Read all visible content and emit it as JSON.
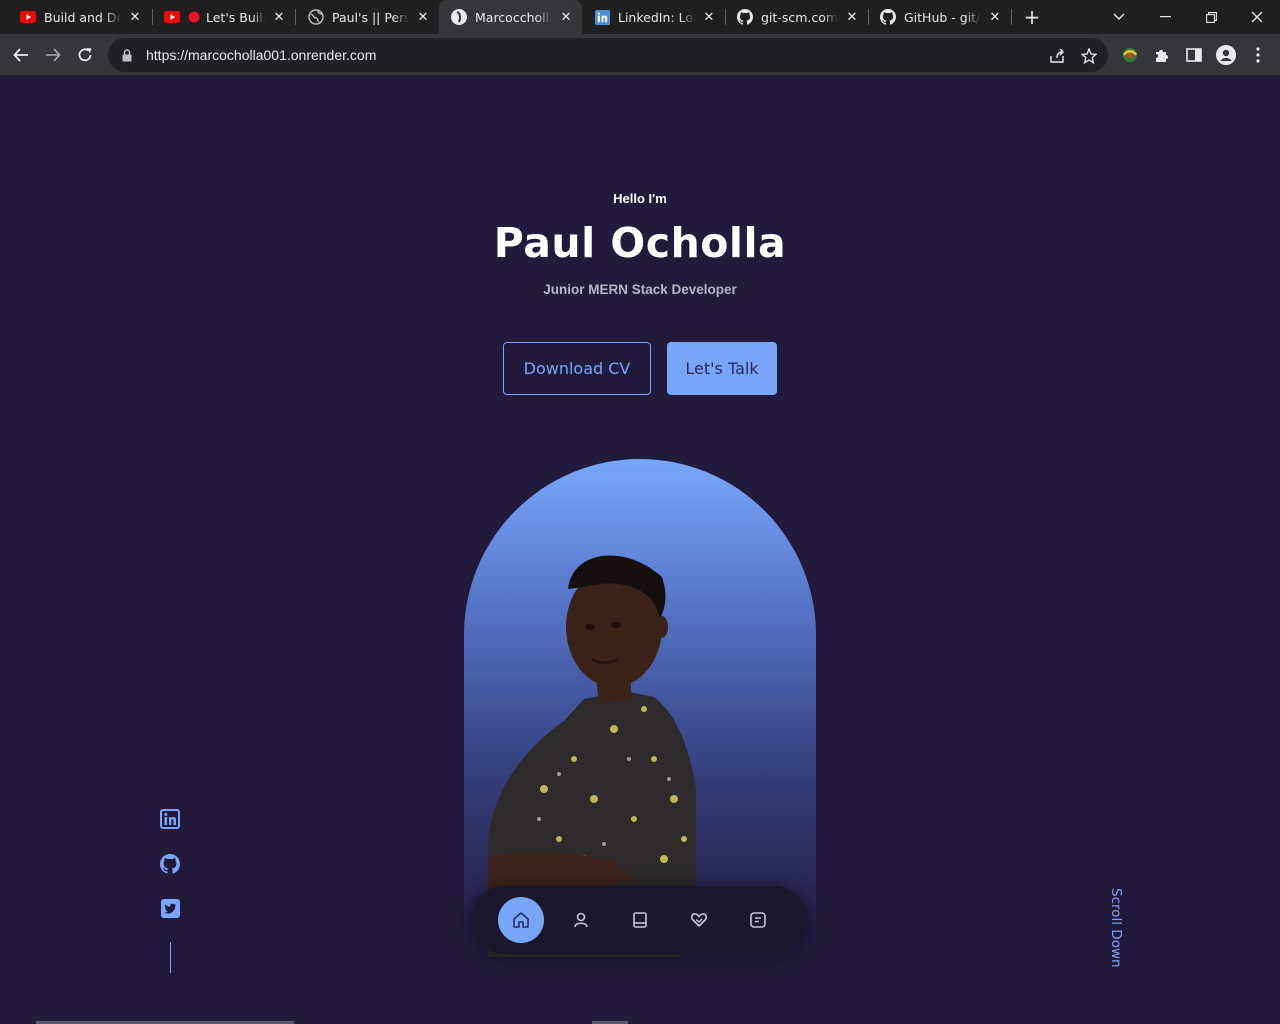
{
  "browser": {
    "tabs": [
      {
        "title": "Build and Deploy a",
        "icon": "youtube-icon"
      },
      {
        "title": "Let's Build a",
        "icon": "youtube-live-icon"
      },
      {
        "title": "Paul's || Personal",
        "icon": "globe-icon"
      },
      {
        "title": "Marcoccholla",
        "icon": "site-avatar-icon"
      },
      {
        "title": "LinkedIn: Log In",
        "icon": "linkedin-icon"
      },
      {
        "title": "git-scm.com/book",
        "icon": "github-icon"
      },
      {
        "title": "GitHub - git/git",
        "icon": "github-icon"
      }
    ],
    "active_tab": 3,
    "new_tab_label": "+",
    "url": "https://marcocholla001.onrender.com",
    "colors": {
      "tabbar": "#1f1f1f",
      "toolbar": "#35363a",
      "omnibox": "#202124"
    }
  },
  "hero": {
    "greeting": "Hello I'm",
    "name": "Paul Ocholla",
    "role": "Junior MERN Stack Developer",
    "download_cv_label": "Download CV",
    "lets_talk_label": "Let's Talk",
    "scroll_label": "Scroll Down"
  },
  "bottom_nav": {
    "items": [
      {
        "icon": "home-icon",
        "active": true
      },
      {
        "icon": "user-icon",
        "active": false
      },
      {
        "icon": "book-icon",
        "active": false
      },
      {
        "icon": "services-icon",
        "active": false
      },
      {
        "icon": "message-icon",
        "active": false
      }
    ]
  },
  "socials": [
    {
      "icon": "linkedin-icon"
    },
    {
      "icon": "github-icon"
    },
    {
      "icon": "twitter-icon"
    }
  ],
  "colors": {
    "background": "#211a3a",
    "accent": "#78a6fb",
    "text": "#ffffff",
    "muted_text": "#b8b5c8"
  }
}
